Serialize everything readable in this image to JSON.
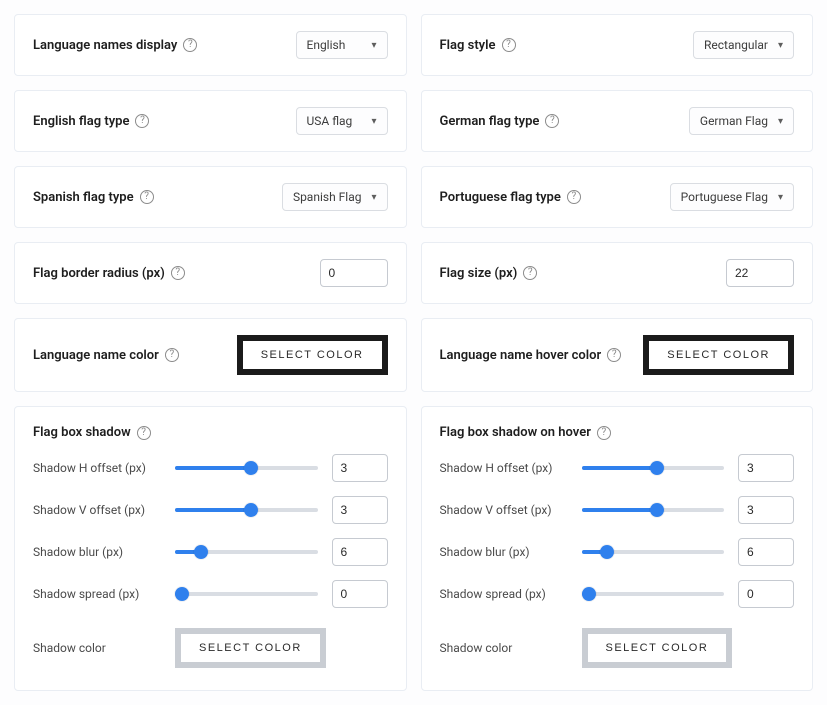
{
  "rows": [
    {
      "left": {
        "label": "Language names display",
        "help": true,
        "control": "select",
        "value": "English"
      },
      "right": {
        "label": "Flag style",
        "help": true,
        "control": "select",
        "value": "Rectangular"
      }
    },
    {
      "left": {
        "label": "English flag type",
        "help": true,
        "control": "select",
        "value": "USA flag"
      },
      "right": {
        "label": "German flag type",
        "help": true,
        "control": "select",
        "value": "German Flag"
      }
    },
    {
      "left": {
        "label": "Spanish flag type",
        "help": true,
        "control": "select",
        "value": "Spanish Flag"
      },
      "right": {
        "label": "Portuguese flag type",
        "help": true,
        "control": "select",
        "value": "Portuguese Flag"
      }
    },
    {
      "left": {
        "label": "Flag border radius (px)",
        "help": true,
        "control": "number",
        "value": "0"
      },
      "right": {
        "label": "Flag size (px)",
        "help": true,
        "control": "number",
        "value": "22"
      }
    },
    {
      "left": {
        "label": "Language name color",
        "help": true,
        "control": "color",
        "value": "SELECT COLOR"
      },
      "right": {
        "label": "Language name hover color",
        "help": true,
        "control": "color",
        "value": "SELECT COLOR"
      }
    }
  ],
  "shadow": {
    "left_title": "Flag box shadow",
    "right_title": "Flag box shadow on hover",
    "items": [
      {
        "label": "Shadow H offset (px)",
        "value": "3",
        "pct": 53
      },
      {
        "label": "Shadow V offset (px)",
        "value": "3",
        "pct": 53
      },
      {
        "label": "Shadow blur (px)",
        "value": "6",
        "pct": 18
      },
      {
        "label": "Shadow spread (px)",
        "value": "0",
        "pct": 5
      }
    ],
    "color_label": "Shadow color",
    "color_btn": "SELECT COLOR"
  }
}
